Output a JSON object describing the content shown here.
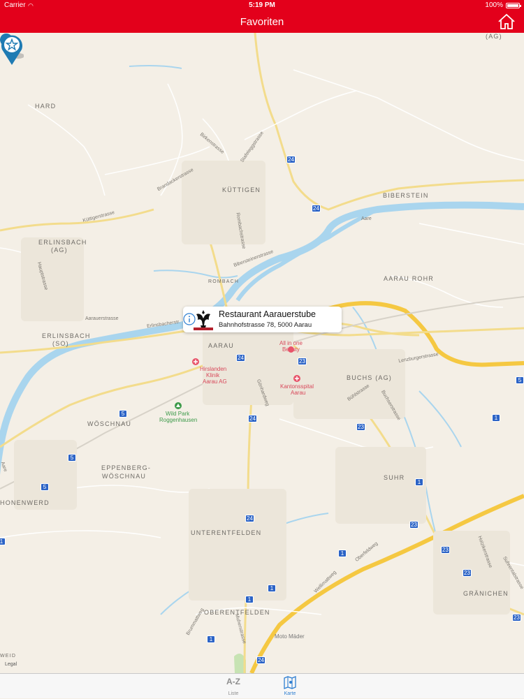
{
  "status_bar": {
    "carrier": "Carrier",
    "time": "5:19 PM",
    "battery": "100%"
  },
  "nav": {
    "title": "Favoriten"
  },
  "callout": {
    "name": "Restaurant Aarauerstube",
    "address": "Bahnhofstrasse 78, 5000 Aarau"
  },
  "map": {
    "places": [
      "HARD",
      "KÜTTIGEN",
      "BIBERSTEIN",
      "ERLINSBACH",
      "(AG)",
      "AARAU ROHR",
      "ERLINSBACH",
      "(SO)",
      "ROMBACH",
      "AARAU",
      "BUCHS (AG)",
      "WÖSCHNAU",
      "EPPENBERG-",
      "WÖSCHNAU",
      "SUHR",
      "HONENWERD",
      "UNTERENTFELDEN",
      "OBERENTFELDEN",
      "GRÄNICHEN",
      "(AG)",
      "WEID"
    ],
    "streets": [
      "Birkenstrasse",
      "Stafeleggstrasse",
      "Brandackerstrasse",
      "Küttigerstrasse",
      "Hauptstrasse",
      "Aarauerstrasse",
      "Erlinsbacherstr.",
      "Bibersteinerstrasse",
      "Aare",
      "Aare",
      "Rombachstrasse",
      "Lenzburgerstrasse",
      "Bühlstrasse",
      "Buchserstrasse",
      "Gönhardweg",
      "Wellimattweg",
      "Oberfeldweg",
      "Holzikerstrasse",
      "Suhrentalstrasse",
      "Brummattweg",
      "Muhenstrasse"
    ],
    "pois": [
      "Hirslanden",
      "Klinik",
      "Aarau AG",
      "Kantonsspital",
      "Aarau",
      "All in one",
      "Beauty",
      "Wild Park",
      "Roggenhausen",
      "Moto Mäder"
    ],
    "shields": [
      "24",
      "24",
      "24",
      "24",
      "24",
      "24",
      "23",
      "23",
      "23",
      "23",
      "23",
      "23",
      "5",
      "5",
      "5",
      "5",
      "1",
      "1",
      "1",
      "1",
      "1",
      "1",
      "1"
    ],
    "legal": "Legal"
  },
  "tabs": {
    "list_icon": "A-Z",
    "list_label": "Liste",
    "map_label": "Karte"
  },
  "colors": {
    "brand_red": "#e3001b",
    "water": "#a9d5ee",
    "pin_blue": "#1f7bb3",
    "tab_active": "#2f7fd1"
  }
}
